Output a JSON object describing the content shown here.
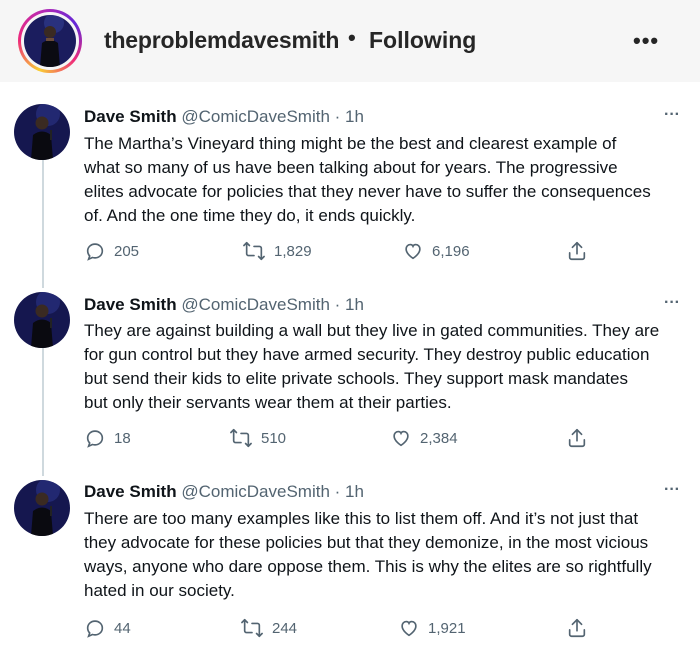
{
  "instagram": {
    "username": "theproblemdavesmith",
    "separator": "•",
    "follow_status": "Following",
    "more_icon": "more-horizontal-icon"
  },
  "tweets": [
    {
      "name": "Dave Smith",
      "handle": "@ComicDaveSmith · 1h",
      "lines": [
        "The Martha’s Vineyard thing might be the best and clearest example of",
        "what so many of us have been talking about for years. The progressive",
        "elites advocate for policies that they never have to suffer the consequences",
        "of. And the one time they do, it ends quickly."
      ],
      "replies": "205",
      "retweets": "1,829",
      "likes": "6,196"
    },
    {
      "name": "Dave Smith",
      "handle": "@ComicDaveSmith · 1h",
      "lines": [
        "They are against building a wall but they live in gated communities. They are",
        "for gun control but they have armed security. They destroy public education",
        "but send their kids to elite private schools. They support mask mandates",
        "but only their servants wear them at their parties."
      ],
      "replies": "18",
      "retweets": "510",
      "likes": "2,384"
    },
    {
      "name": "Dave Smith",
      "handle": "@ComicDaveSmith · 1h",
      "lines": [
        "There are too many examples like this to list them off. And it’s not just that",
        "they advocate for these policies but that they demonize, in the most vicious",
        "ways, anyone who dare oppose them. This is why the elites are so rightfully",
        "hated in our society."
      ],
      "replies": "44",
      "retweets": "244",
      "likes": "1,921"
    }
  ],
  "more_glyph": "···",
  "colors": {
    "text": "#0f1419",
    "secondary": "#536471",
    "thread_line": "#cfd9de",
    "ig_header_bg": "#f6f6f6"
  }
}
